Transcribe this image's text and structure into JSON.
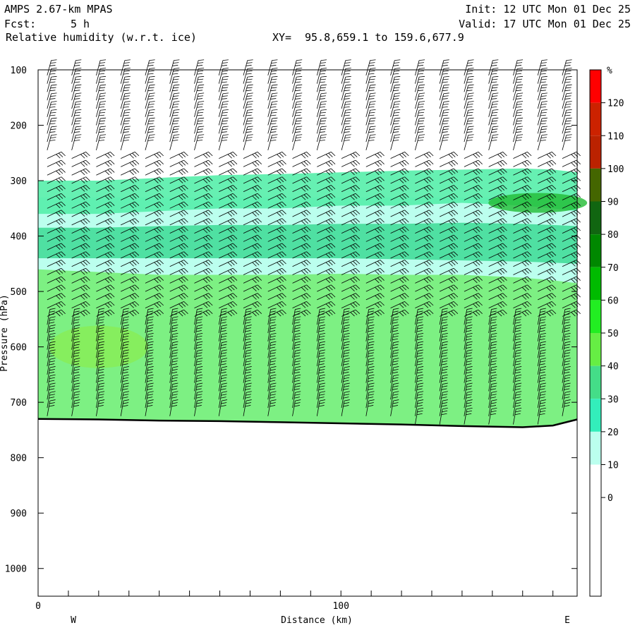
{
  "header": {
    "model": "AMPS 2.67-km MPAS",
    "fcst_label": "Fcst:",
    "fcst_value": "5 h",
    "field": "Relative humidity (w.r.t. ice)",
    "xy_label": "XY=",
    "xy_value": "95.8,659.1 to 159.6,677.9",
    "init": "Init: 12 UTC Mon 01 Dec 25",
    "valid": "Valid: 17 UTC Mon 01 Dec 25"
  },
  "chart_data": {
    "type": "heatmap",
    "title": "Relative humidity (w.r.t. ice)",
    "xlabel": "Distance (km)",
    "ylabel": "Pressure (hPa)",
    "xlim": [
      0,
      178
    ],
    "ylim": [
      1050,
      100
    ],
    "x_ticks": [
      "0",
      "100"
    ],
    "y_ticks": [
      "100",
      "200",
      "300",
      "400",
      "500",
      "600",
      "700",
      "800",
      "900",
      "1000"
    ],
    "y_tick_values": [
      100,
      200,
      300,
      400,
      500,
      600,
      700,
      800,
      900,
      1000
    ],
    "x_endpoints": {
      "left": "W",
      "right": "E"
    },
    "colorbar": {
      "unit": "%",
      "levels": [
        "120",
        "110",
        "100",
        "90",
        "80",
        "70",
        "60",
        "50",
        "40",
        "30",
        "20",
        "10",
        "0"
      ],
      "colors": [
        "#ff0000",
        "#cc2200",
        "#bb2200",
        "#446600",
        "#116611",
        "#008800",
        "#00bb00",
        "#22ee22",
        "#66ee44",
        "#44dd88",
        "#33eebb",
        "#bbffee",
        "#ffffff",
        "#ffffff",
        "#ffffff",
        "#ffffff"
      ]
    },
    "surface_pressure": [
      [
        0,
        730
      ],
      [
        20,
        731
      ],
      [
        40,
        733
      ],
      [
        60,
        734
      ],
      [
        80,
        736
      ],
      [
        100,
        738
      ],
      [
        120,
        740
      ],
      [
        140,
        743
      ],
      [
        160,
        745
      ],
      [
        170,
        742
      ],
      [
        178,
        731
      ]
    ],
    "humidity_bands": [
      {
        "name": "ice-saturated-layer-upper",
        "level_pct": 45,
        "p_top": [
          300,
          300,
          295,
          290,
          288,
          285,
          282,
          280,
          278,
          280,
          285
        ],
        "p_bot": [
          360,
          360,
          355,
          350,
          350,
          345,
          345,
          340,
          345,
          350,
          355
        ]
      },
      {
        "name": "moist-layer-mid",
        "level_pct": 50,
        "p_top": [
          385,
          385,
          382,
          380,
          380,
          378,
          378,
          376,
          378,
          380,
          382
        ],
        "p_bot": [
          440,
          440,
          440,
          440,
          440,
          440,
          442,
          444,
          446,
          448,
          450
        ]
      },
      {
        "name": "moist-layer-low",
        "level_pct": 55,
        "p_top": [
          460,
          465,
          470,
          470,
          470,
          468,
          470,
          470,
          475,
          480,
          485
        ],
        "p_bot": [
          730,
          731,
          733,
          734,
          736,
          738,
          740,
          743,
          745,
          742,
          731
        ]
      }
    ]
  }
}
